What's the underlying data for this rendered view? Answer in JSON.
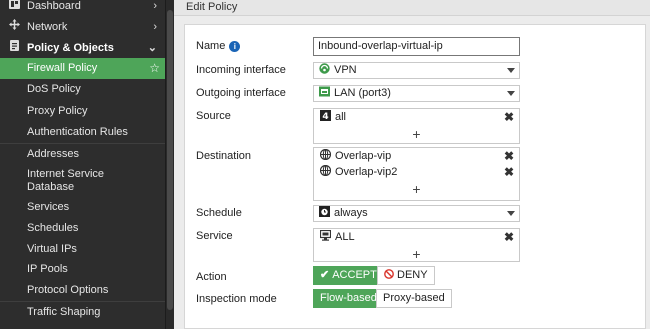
{
  "sidebar": {
    "items": [
      {
        "label": "Dashboard",
        "icon": "dashboard-icon",
        "chevron": "›"
      },
      {
        "label": "Network",
        "icon": "network-icon",
        "chevron": "›"
      },
      {
        "label": "Policy & Objects",
        "icon": "policy-icon",
        "chevron": "⌄"
      },
      {
        "label": "Firewall Policy"
      },
      {
        "label": "DoS Policy"
      },
      {
        "label": "Proxy Policy"
      },
      {
        "label": "Authentication Rules"
      },
      {
        "label": "Addresses"
      },
      {
        "label": "Internet Service Database"
      },
      {
        "label": "Services"
      },
      {
        "label": "Schedules"
      },
      {
        "label": "Virtual IPs"
      },
      {
        "label": "IP Pools"
      },
      {
        "label": "Protocol Options"
      },
      {
        "label": "Traffic Shaping"
      }
    ]
  },
  "page": {
    "title": "Edit Policy"
  },
  "form": {
    "name_label": "Name",
    "name_value": "Inbound-overlap-virtual-ip",
    "incoming_label": "Incoming interface",
    "incoming_value": "VPN",
    "outgoing_label": "Outgoing interface",
    "outgoing_value": "LAN (port3)",
    "source_label": "Source",
    "source_entries": [
      "all"
    ],
    "destination_label": "Destination",
    "destination_entries": [
      "Overlap-vip",
      "Overlap-vip2"
    ],
    "schedule_label": "Schedule",
    "schedule_value": "always",
    "service_label": "Service",
    "service_entries": [
      "ALL"
    ],
    "action_label": "Action",
    "action_accept": "ACCEPT",
    "action_deny": "DENY",
    "inspection_label": "Inspection mode",
    "inspection_flow": "Flow-based",
    "inspection_proxy": "Proxy-based",
    "remove_glyph": "✖",
    "add_glyph": "+"
  },
  "colors": {
    "accent": "#4ea559",
    "sidebar_bg": "#2d2d2d",
    "info_blue": "#1a64b6",
    "deny_red": "#d9342b"
  }
}
